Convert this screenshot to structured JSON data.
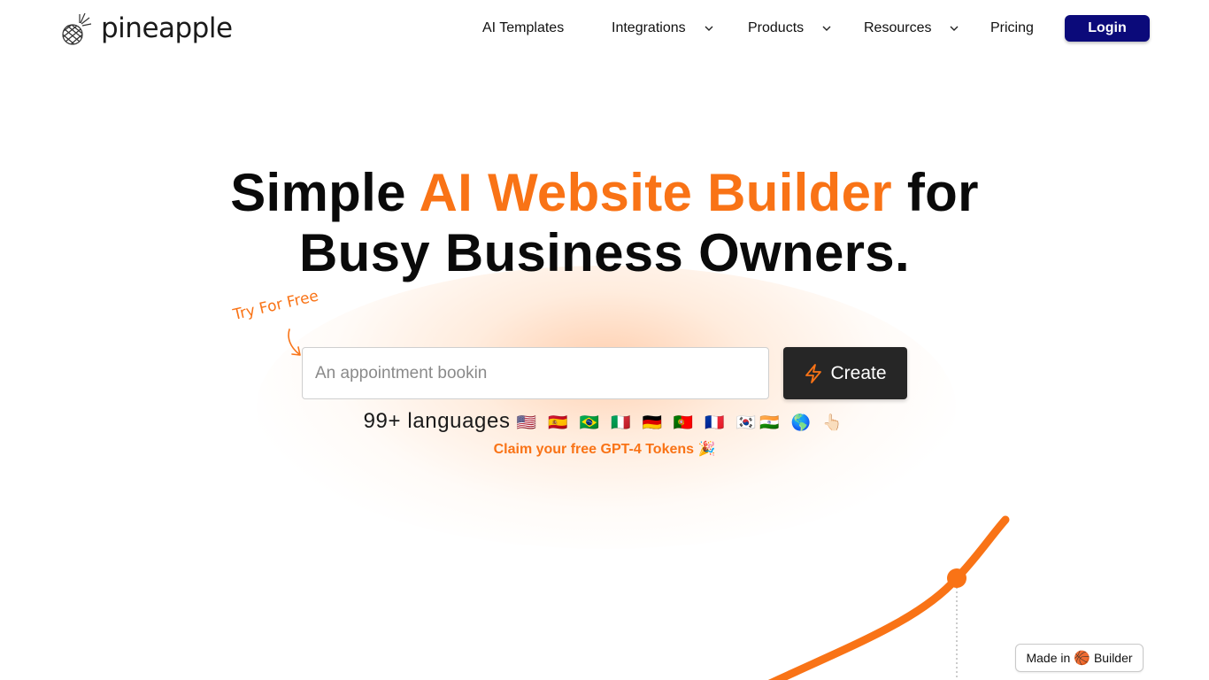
{
  "brand": {
    "name": "pineapple",
    "logo_icon": "pineapple-icon"
  },
  "nav": {
    "items": [
      {
        "label": "AI Templates",
        "has_dropdown": false
      },
      {
        "label": "Integrations",
        "has_dropdown": true
      },
      {
        "label": "Products",
        "has_dropdown": true
      },
      {
        "label": "Resources",
        "has_dropdown": true
      },
      {
        "label": "Pricing",
        "has_dropdown": false
      }
    ],
    "login_label": "Login"
  },
  "hero": {
    "headline_pre": "Simple ",
    "headline_accent": "AI Website Builder",
    "headline_post": " for",
    "headline_line2": "Busy Business Owners.",
    "try_free": "Try For Free",
    "input_placeholder": "An appointment bookin",
    "create_label": "Create",
    "languages_text": "99+ languages",
    "language_flags": "🇺🇸 🇪🇸 🇧🇷 🇮🇹 🇩🇪 🇵🇹 🇫🇷 🇰🇷🇮🇳 🌎 👆🏻",
    "claim_text": "Claim your free GPT-4 Tokens 🎉"
  },
  "badge": {
    "prefix": "Made in",
    "icon": "🏀",
    "suffix": "Builder"
  },
  "colors": {
    "accent": "#f97316",
    "login_bg": "#0b0a7a",
    "create_bg": "#262626"
  }
}
